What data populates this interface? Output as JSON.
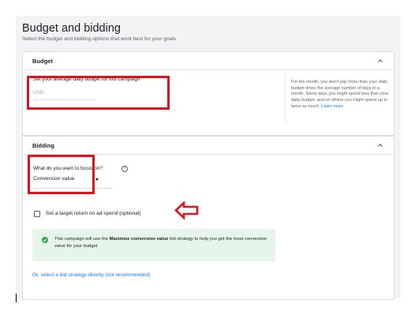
{
  "header": {
    "title": "Budget and bidding",
    "subtitle": "Select the budget and bidding options that work best for your goals"
  },
  "budget": {
    "title": "Budget",
    "field_label": "Set your average daily budget for this campaign",
    "currency_placeholder": "USD",
    "note_text": "For the month, you won't pay more than your daily budget times the average number of days in a month. Some days you might spend less than your daily budget, and on others you might spend up to twice as much.",
    "note_link": "Learn more"
  },
  "bidding": {
    "title": "Bidding",
    "focus_label": "What do you want to focus on?",
    "help_glyph": "?",
    "focus_value": "Conversion value",
    "checkbox_label": "Set a target return on ad spend (optional)",
    "checkbox_checked": false,
    "notice_prefix": "This campaign will use the ",
    "notice_strategy": "Maximize conversion value",
    "notice_suffix": " bid strategy to help you get the most conversion value for your budget",
    "strategy_link": "Or, select a bid strategy directly (not recommended)"
  },
  "colors": {
    "highlight": "#e0121b",
    "link": "#1a73e8",
    "notice_bg": "#e6f4ea",
    "success": "#34a853"
  }
}
